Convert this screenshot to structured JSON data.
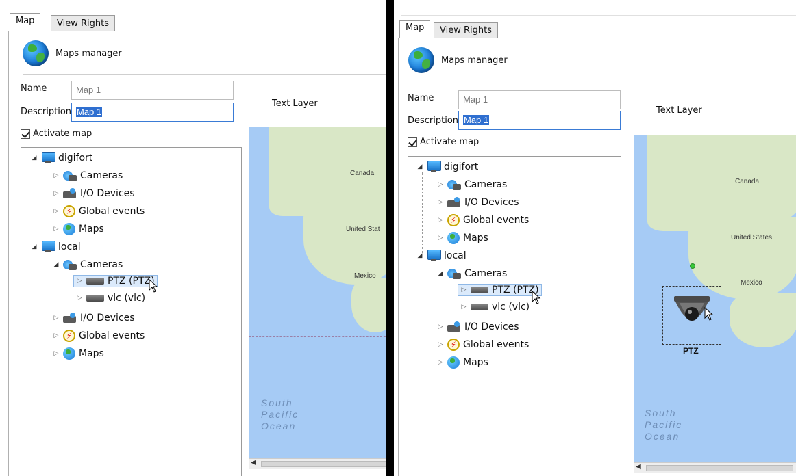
{
  "tabs": {
    "map": "Map",
    "view_rights": "View Rights"
  },
  "manager": {
    "title": "Maps manager"
  },
  "form": {
    "name_label": "Name",
    "name_value": "Map 1",
    "description_label": "Description",
    "description_value": "Map 1",
    "activate_label": "Activate map"
  },
  "tree": {
    "server1": "digifort",
    "server1_children": [
      "Cameras",
      "I/O Devices",
      "Global events",
      "Maps"
    ],
    "server2": "local",
    "cameras": "Cameras",
    "camera_items": [
      "PTZ (PTZ)",
      "vlc (vlc)"
    ],
    "server2_rest": [
      "I/O Devices",
      "Global events",
      "Maps"
    ]
  },
  "map_panel": {
    "text_layer": "Text Layer",
    "labels": {
      "canada": "Canada",
      "us_left": "United Stat",
      "us_right": "United States",
      "mexico": "Mexico"
    },
    "ocean": [
      "South",
      "Pacific",
      "Ocean"
    ]
  },
  "placed_camera": {
    "label": "PTZ"
  },
  "colors": {
    "selection": "#2f6fd0",
    "water": "#a6cbf5",
    "land": "#d9e7c6",
    "divider": "#000000"
  }
}
